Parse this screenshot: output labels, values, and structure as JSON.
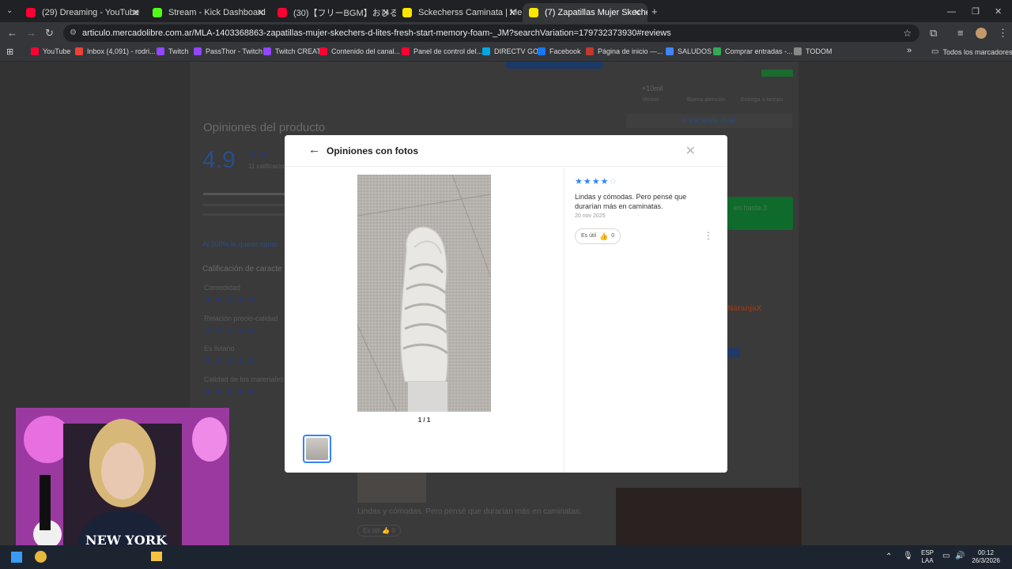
{
  "browser": {
    "tabs": [
      {
        "title": "(29) Dreaming - YouTube",
        "color": "#ff0033"
      },
      {
        "title": "Stream - Kick Dashboard",
        "color": "#53fc18"
      },
      {
        "title": "(30)【フリーBGM】おひるすぎ[…",
        "color": "#ff0033"
      },
      {
        "title": "Sckecherss Caminata | Mercado",
        "color": "#ffe600"
      },
      {
        "title": "(7) Zapatillas Mujer Skechers D",
        "color": "#ffe600"
      }
    ],
    "url": "articulo.mercadolibre.com.ar/MLA-1403368863-zapatillas-mujer-skechers-d-lites-fresh-start-memory-foam-_JM?searchVariation=179732373930#reviews",
    "bookmarks": [
      {
        "label": "YouTube",
        "color": "#ff0033"
      },
      {
        "label": "Inbox (4,091) - rodri...",
        "color": "#ea4335"
      },
      {
        "label": "Twitch",
        "color": "#9146ff"
      },
      {
        "label": "PassThor - Twitch",
        "color": "#9146ff"
      },
      {
        "label": "Twitch CREAT",
        "color": "#9146ff"
      },
      {
        "label": "Contenido del canal...",
        "color": "#ff0033"
      },
      {
        "label": "Panel de control del...",
        "color": "#ff0033"
      },
      {
        "label": "DIRECTV GO",
        "color": "#00a8e1"
      },
      {
        "label": "Facebook",
        "color": "#1877f2"
      },
      {
        "label": "Página de inicio —...",
        "color": "#c0392b"
      },
      {
        "label": "SALUDOS",
        "color": "#4285f4"
      },
      {
        "label": "Comprar entradas -...",
        "color": "#34a853"
      },
      {
        "label": "TODOM",
        "color": "#888888"
      }
    ],
    "all_bookmarks": "Todos los marcadores"
  },
  "background_page": {
    "section_title": "Opiniones del producto",
    "rating": "4.9",
    "ratings_count": "11 calificaciones",
    "recommend_text": "Al 100% le quedó como",
    "characteristics_title": "Calificación de caracte",
    "characteristics": [
      "Comodidad",
      "Relación precio-calidad",
      "Es liviano",
      "Calidad de los materiales"
    ],
    "right_stats": [
      "+10mil",
      "Ventas",
      "Buena atención",
      "Entrega a tiempo"
    ],
    "store_link": "Ir a la tienda oficial",
    "installments_text": "en hasta 3",
    "naranjax": "NaranjaX",
    "bottom_review": "Lindas y cómodas. Pero pensé que durarían más en caminatas.",
    "bottom_useful": "Es útil",
    "bottom_useful_count": "0"
  },
  "modal": {
    "title": "Opiniones con fotos",
    "counter": "1 / 1",
    "stars_filled": 4,
    "stars_total": 5,
    "review_text": "Lindas y cómodas. Pero pensé que durarían más en caminatas.",
    "date": "20 nov 2025",
    "useful_label": "Es útil",
    "useful_count": "0",
    "colors": {
      "star": "#3483fa",
      "accent": "#3483fa"
    }
  },
  "webcam_overlay": {
    "shirt_text": "NEW YORK"
  },
  "taskbar": {
    "lang": "ESP",
    "lang2": "LAA",
    "time": "00:12",
    "date": "26/3/2026"
  }
}
